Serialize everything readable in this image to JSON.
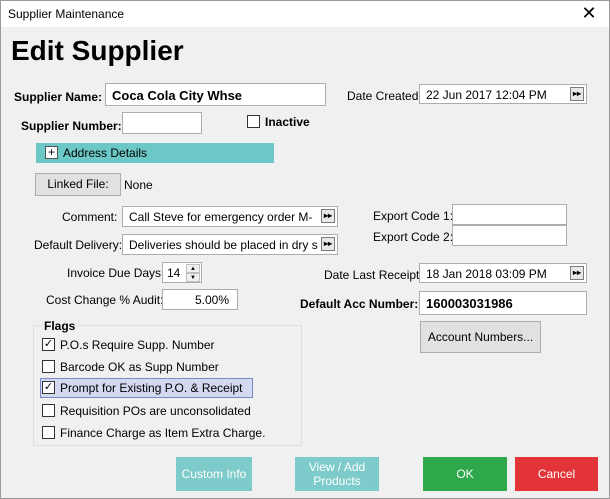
{
  "window": {
    "title": "Supplier Maintenance",
    "close_glyph": "✕"
  },
  "header": {
    "title": "Edit Supplier"
  },
  "supplier_name": {
    "label": "Supplier Name:",
    "value": "Coca Cola City Whse"
  },
  "supplier_number": {
    "label": "Supplier Number:",
    "value": ""
  },
  "inactive": {
    "label": "Inactive",
    "checked": false
  },
  "date_created": {
    "label": "Date Created:",
    "value": "22 Jun 2017 12:04 PM"
  },
  "address_details": {
    "label": "Address Details",
    "toggle_glyph": "+"
  },
  "linked_file": {
    "button_label": "Linked File:",
    "value": "None"
  },
  "comment": {
    "label": "Comment:",
    "value": "Call Steve for emergency order M-"
  },
  "default_delivery": {
    "label": "Default Delivery:",
    "value": "Deliveries should be placed in dry s"
  },
  "export_code_1": {
    "label": "Export Code 1:",
    "value": ""
  },
  "export_code_2": {
    "label": "Export Code 2:",
    "value": ""
  },
  "invoice_due_days": {
    "label": "Invoice Due Days:",
    "value": "14"
  },
  "date_last_receipt": {
    "label": "Date Last Receipt:",
    "value": "18 Jan 2018 03:09 PM"
  },
  "cost_change_audit": {
    "label": "Cost Change % Audit:",
    "value": "5.00%"
  },
  "default_acc_number": {
    "label": "Default Acc Number:",
    "value": "160003031986"
  },
  "account_numbers_button": {
    "label": "Account Numbers..."
  },
  "flags": {
    "title": "Flags",
    "items": [
      {
        "label": "P.O.s Require Supp. Number",
        "checked": true
      },
      {
        "label": "Barcode OK as Supp Number",
        "checked": false
      },
      {
        "label": "Prompt for Existing P.O. & Receipt",
        "checked": true
      },
      {
        "label": "Requisition POs are unconsolidated",
        "checked": false
      },
      {
        "label": "Finance Charge as Item Extra Charge.",
        "checked": false
      }
    ]
  },
  "footer": {
    "custom_info": "Custom Info",
    "view_add_products_line1": "View / Add",
    "view_add_products_line2": "Products",
    "ok": "OK",
    "cancel": "Cancel"
  },
  "colors": {
    "address_bar": "#6cc7c7",
    "teal_button": "#7ecbcb",
    "ok_button": "#2ea84a",
    "cancel_button": "#e3343a"
  },
  "glyphs": {
    "check": "✓",
    "dt_button": "▸▸",
    "spin_up": "▲",
    "spin_down": "▼"
  }
}
